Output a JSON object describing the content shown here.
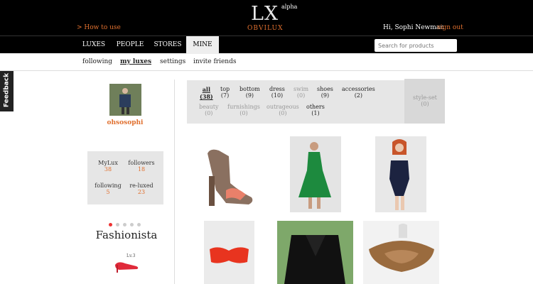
{
  "header": {
    "how_to_use": "> How to use",
    "logo_text": "LX",
    "logo_badge": "alpha",
    "logo_name": "OBVILUX",
    "greeting": "Hi, Sophi Newman",
    "sign_out": "sign out"
  },
  "nav": {
    "tabs": [
      "LUXES",
      "PEOPLE",
      "STORES",
      "MINE"
    ],
    "active": "MINE",
    "search_placeholder": "Search for products"
  },
  "subnav": {
    "items": [
      "following",
      "my luxes",
      "settings",
      "invite friends"
    ],
    "selected": "my luxes"
  },
  "feedback_label": "Feedback",
  "profile": {
    "username": "ohsosophi",
    "stats": [
      {
        "label": "MyLux",
        "value": "38"
      },
      {
        "label": "followers",
        "value": "18"
      },
      {
        "label": "following",
        "value": "5"
      },
      {
        "label": "re-luxed",
        "value": "23"
      }
    ],
    "rank": "Fashionista",
    "level": "Lv.3"
  },
  "categories": {
    "row1": [
      {
        "name": "all",
        "count": "(38)"
      },
      {
        "name": "top",
        "count": "(7)"
      },
      {
        "name": "bottom",
        "count": "(9)"
      },
      {
        "name": "dress",
        "count": "(10)"
      },
      {
        "name": "swim",
        "count": "(0)"
      },
      {
        "name": "shoes",
        "count": "(9)"
      },
      {
        "name": "accessories",
        "count": "(2)"
      }
    ],
    "row2": [
      {
        "name": "beauty",
        "count": "(0)"
      },
      {
        "name": "furnishings",
        "count": "(0)"
      },
      {
        "name": "outrageous",
        "count": "(0)"
      },
      {
        "name": "others",
        "count": "(1)"
      }
    ],
    "style_set": {
      "name": "style-set",
      "count": "(0)"
    }
  },
  "colors": {
    "accent": "#e0702f",
    "topbar": "#000000",
    "panel": "#e6e6e6"
  }
}
